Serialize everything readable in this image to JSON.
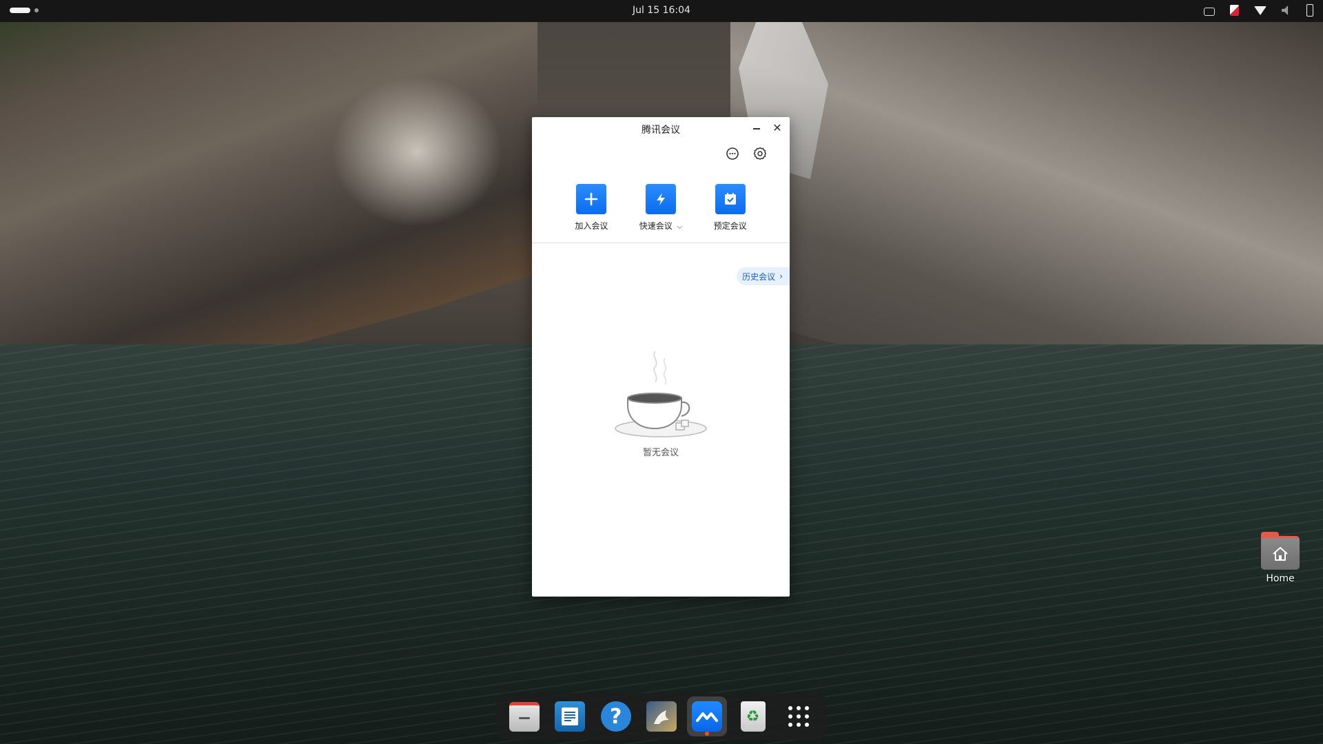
{
  "topbar": {
    "clock": "Jul 15  16:04",
    "tray_icons": [
      "keyboard-icon",
      "app-indicator-icon",
      "wifi-icon",
      "volume-muted-icon",
      "battery-icon"
    ]
  },
  "window": {
    "title": "腾讯会议",
    "actions": [
      {
        "label": "加入会议",
        "icon": "plus-icon"
      },
      {
        "label": "快速会议",
        "icon": "lightning-icon",
        "has_dropdown": true
      },
      {
        "label": "预定会议",
        "icon": "calendar-icon"
      }
    ],
    "history_label": "历史会议",
    "empty_text": "暂无会议",
    "accent_color": "#1a7cff"
  },
  "desktop": {
    "home_label": "Home"
  },
  "dock": {
    "items": [
      {
        "name": "files",
        "icon": "files-icon"
      },
      {
        "name": "libreoffice-writer",
        "icon": "writer-icon"
      },
      {
        "name": "help",
        "icon": "help-icon"
      },
      {
        "name": "gimp-like",
        "icon": "image-editor-icon"
      },
      {
        "name": "tencent-meeting",
        "icon": "tencent-meeting-icon",
        "active": true
      },
      {
        "name": "trash",
        "icon": "trash-icon"
      },
      {
        "name": "show-apps",
        "icon": "app-grid-icon"
      }
    ],
    "accent_color": "#e95420"
  }
}
